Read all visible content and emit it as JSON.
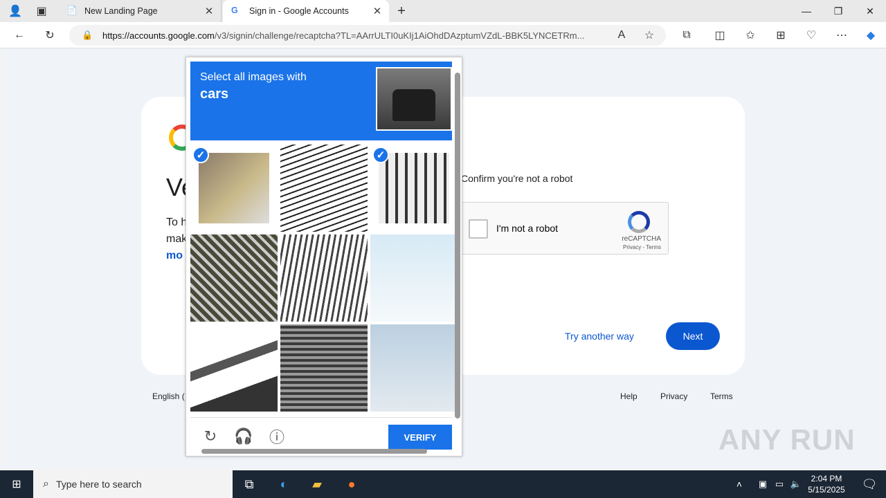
{
  "browser": {
    "tabs": [
      {
        "title": "New Landing Page"
      },
      {
        "title": "Sign in - Google Accounts"
      }
    ],
    "url_host": "https://accounts.google.com",
    "url_path": "/v3/signin/challenge/recaptcha?TL=AArrULTI0uKIj1AiOhdDAzptumVZdL-BBK5LYNCETRm..."
  },
  "page": {
    "heading_partial": "Ve",
    "body_partial_1": "To h",
    "body_partial_2": "mak",
    "body_partial_3": "mo",
    "confirm_text": "Confirm you're not a robot",
    "recaptcha_label": "I'm not a robot",
    "recaptcha_brand": "reCAPTCHA",
    "recaptcha_links": "Privacy - Terms",
    "try_another_way": "Try another way",
    "next_label": "Next",
    "footer_lang_partial": "English (",
    "footer_links": [
      "Help",
      "Privacy",
      "Terms"
    ]
  },
  "challenge": {
    "instruction": "Select all images with",
    "target": "cars",
    "verify_label": "VERIFY",
    "tiles": [
      {
        "selected": true
      },
      {
        "selected": false
      },
      {
        "selected": true
      },
      {
        "selected": false
      },
      {
        "selected": false
      },
      {
        "selected": false
      },
      {
        "selected": false
      },
      {
        "selected": false
      },
      {
        "selected": false
      }
    ]
  },
  "watermark": "ANY RUN",
  "taskbar": {
    "search_placeholder": "Type here to search",
    "time": "2:04 PM",
    "date": "5/15/2025"
  }
}
